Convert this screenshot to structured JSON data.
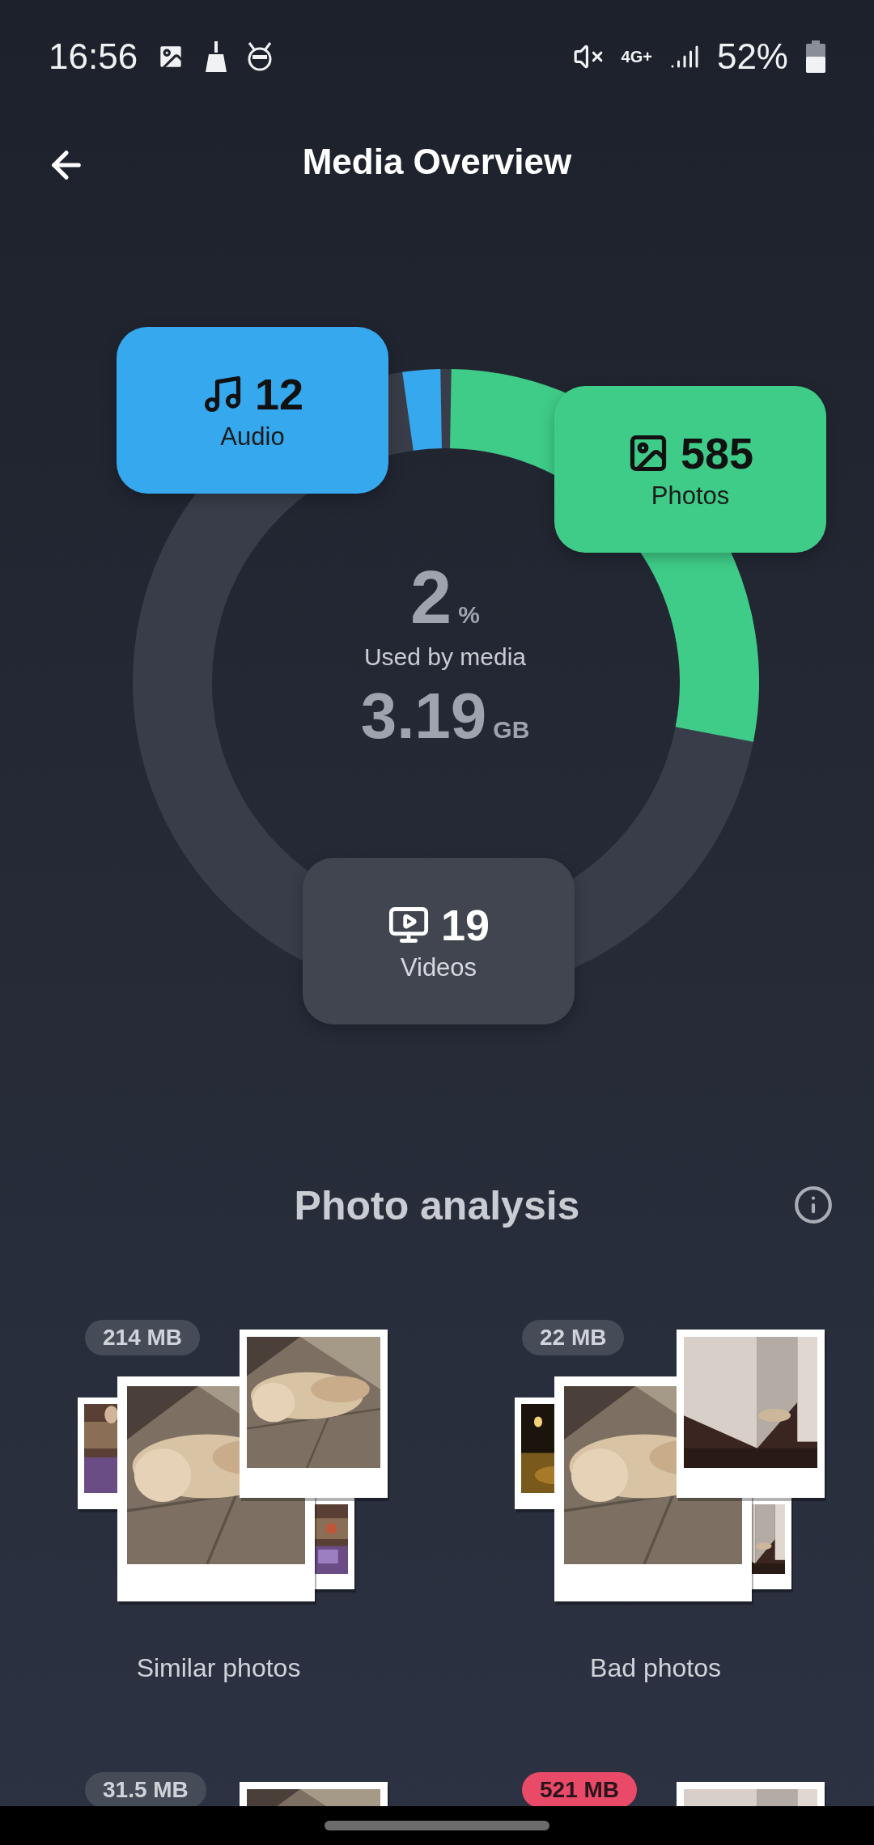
{
  "status_bar": {
    "time": "16:56",
    "network": "4G+",
    "battery": "52%"
  },
  "header": {
    "title": "Media Overview"
  },
  "usage": {
    "percent": "2",
    "percent_unit": "%",
    "caption": "Used by media",
    "size": "3.19",
    "size_unit": "GB"
  },
  "categories": [
    {
      "kind": "audio",
      "count": "12",
      "label": "Audio",
      "color": "#35a8ee"
    },
    {
      "kind": "photos",
      "count": "585",
      "label": "Photos",
      "color": "#3fcc88"
    },
    {
      "kind": "videos",
      "count": "19",
      "label": "Videos",
      "color": "#40454f"
    }
  ],
  "analysis": {
    "title": "Photo analysis",
    "cards": [
      {
        "size": "214 MB",
        "label": "Similar photos",
        "color": "#464b58"
      },
      {
        "size": "22 MB",
        "label": "Bad photos",
        "color": "#464b58"
      },
      {
        "size": "31.5 MB",
        "color": "#464b58"
      },
      {
        "size": "521 MB",
        "color": "#e84a68"
      }
    ]
  }
}
